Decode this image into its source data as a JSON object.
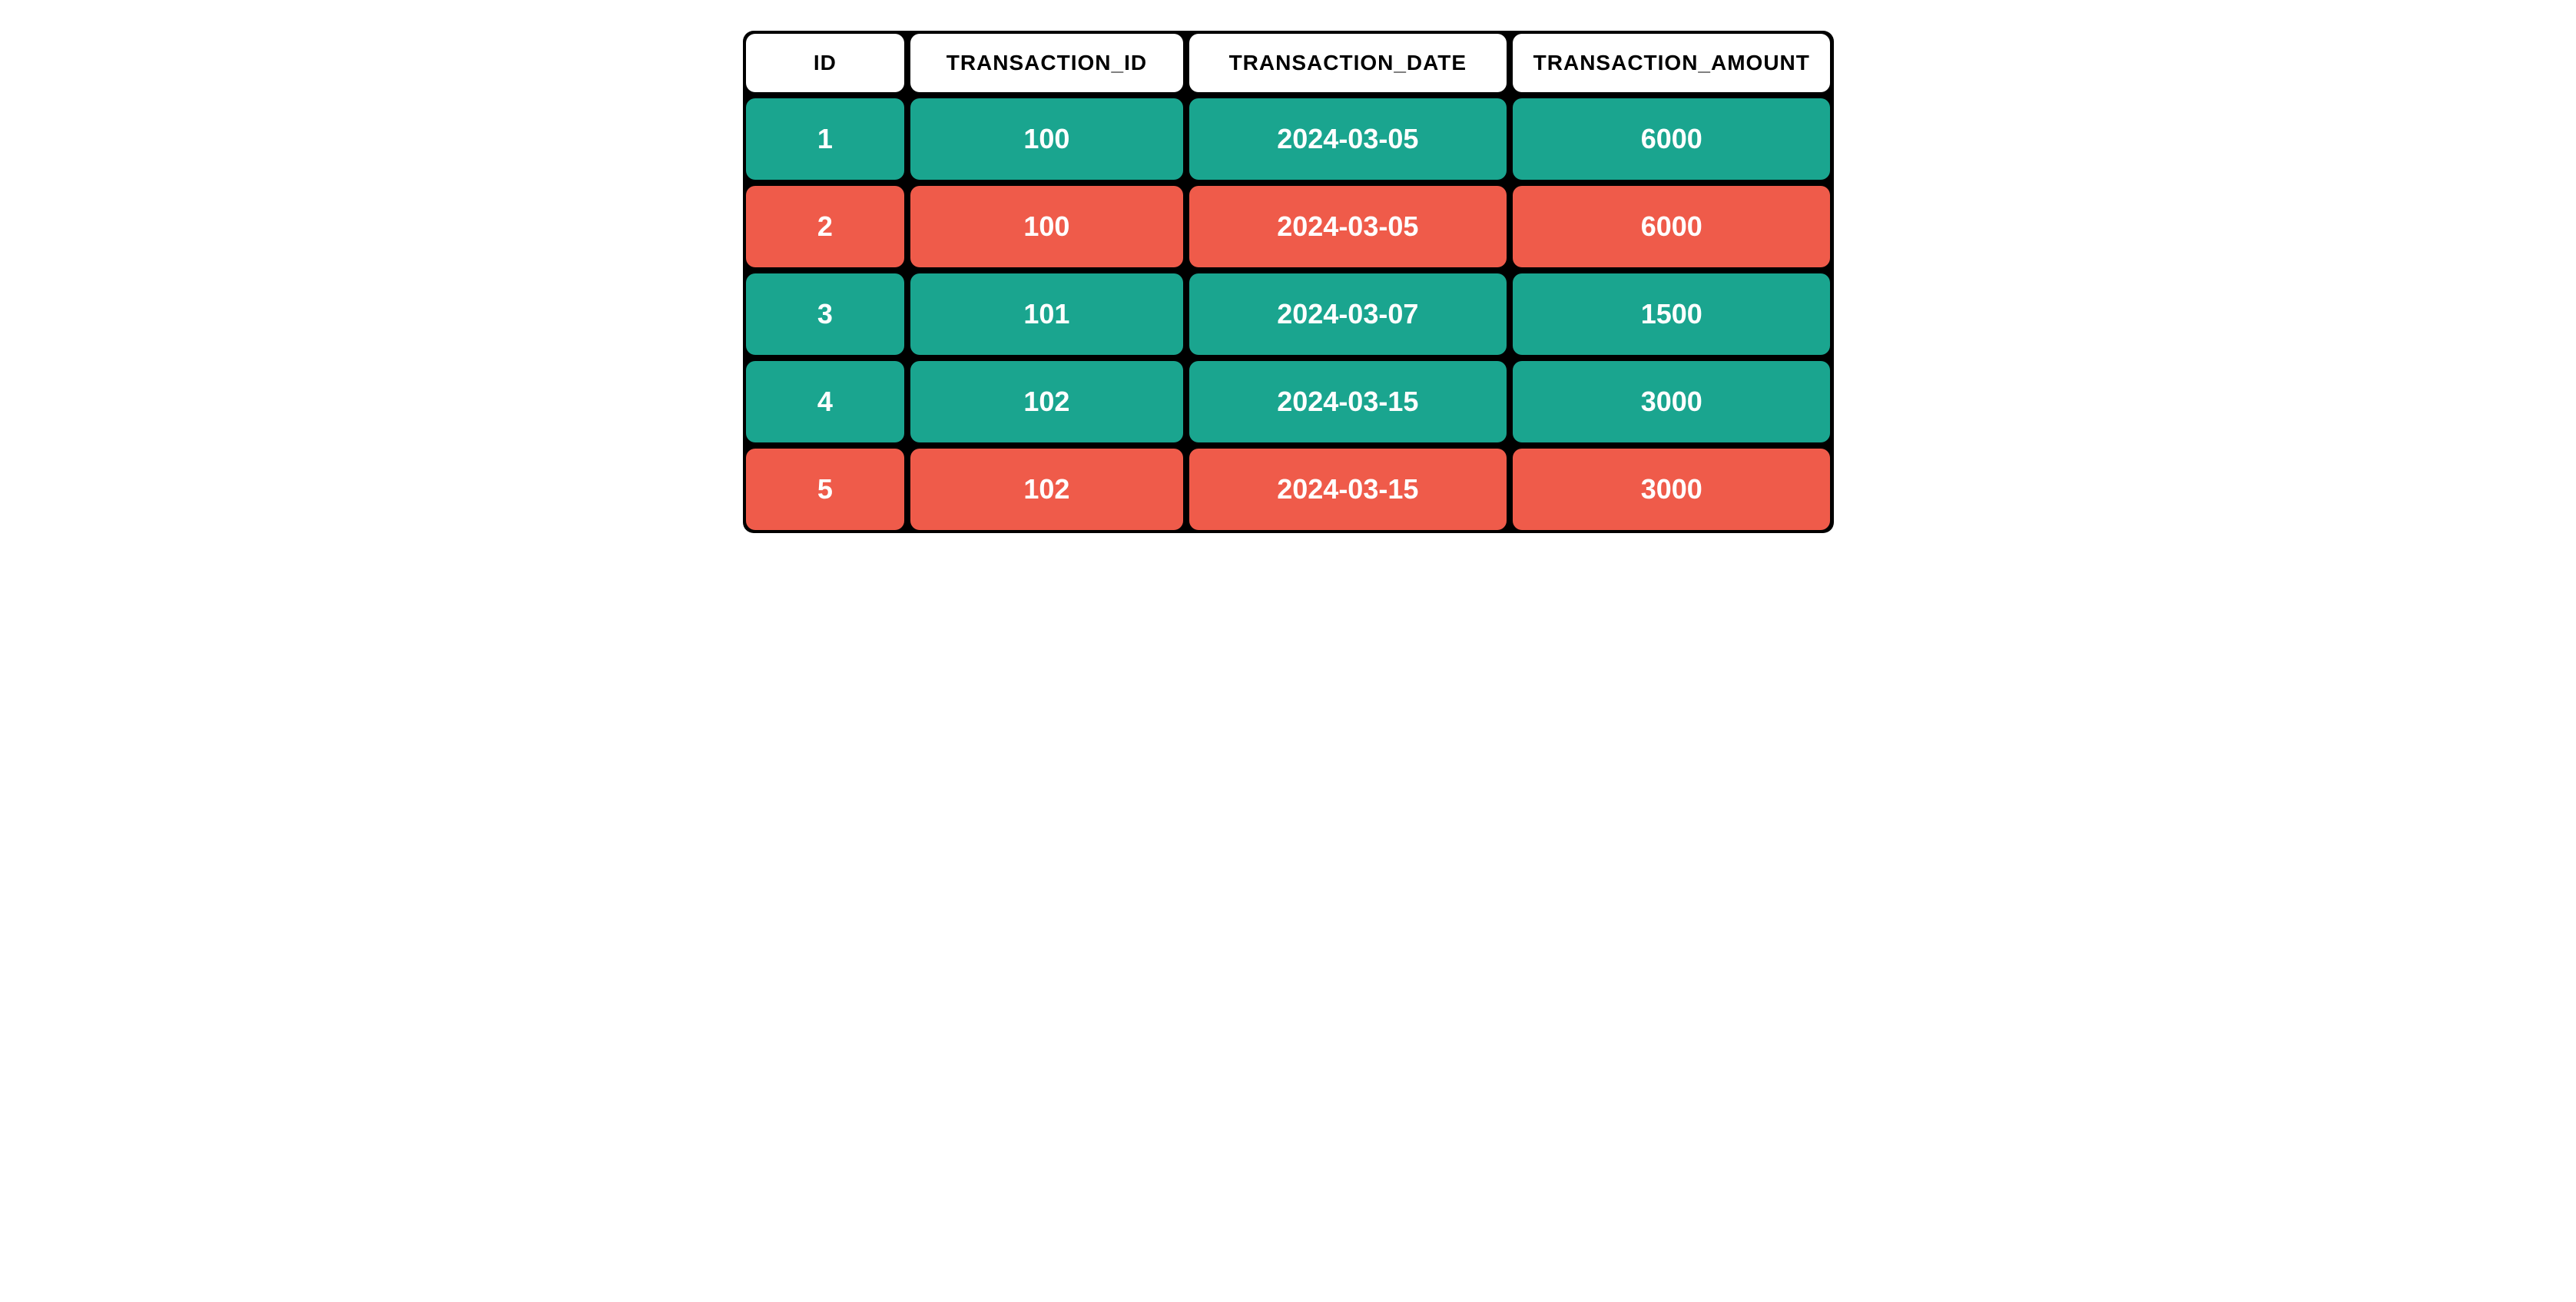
{
  "chart_data": {
    "type": "table",
    "columns": [
      "ID",
      "TRANSACTION_ID",
      "TRANSACTION_DATE",
      "TRANSACTION_AMOUNT"
    ],
    "rows": [
      {
        "id": "1",
        "transaction_id": "100",
        "transaction_date": "2024-03-05",
        "transaction_amount": "6000",
        "color": "teal"
      },
      {
        "id": "2",
        "transaction_id": "100",
        "transaction_date": "2024-03-05",
        "transaction_amount": "6000",
        "color": "red"
      },
      {
        "id": "3",
        "transaction_id": "101",
        "transaction_date": "2024-03-07",
        "transaction_amount": "1500",
        "color": "teal"
      },
      {
        "id": "4",
        "transaction_id": "102",
        "transaction_date": "2024-03-15",
        "transaction_amount": "3000",
        "color": "teal"
      },
      {
        "id": "5",
        "transaction_id": "102",
        "transaction_date": "2024-03-15",
        "transaction_amount": "3000",
        "color": "red"
      }
    ]
  },
  "colors": {
    "teal": "#1aa58f",
    "red": "#ef5b4a",
    "header_bg": "#ffffff",
    "header_text": "#000000",
    "data_text": "#ffffff",
    "border": "#000000"
  }
}
